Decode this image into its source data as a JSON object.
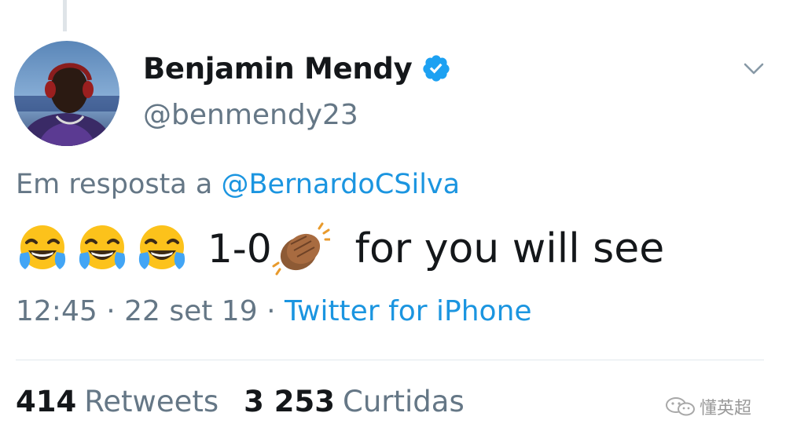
{
  "tweet": {
    "author": {
      "name": "Benjamin Mendy",
      "handle": "@benmendy23"
    },
    "reply_prefix": "Em resposta a ",
    "reply_to": "@BernardoCSilva",
    "text": {
      "emojis": [
        "face-with-tears-of-joy",
        "face-with-tears-of-joy",
        "face-with-tears-of-joy"
      ],
      "score": "1-0",
      "clap_emoji": "clapping-hands",
      "message": "for you will see"
    },
    "meta": {
      "time": "12:45",
      "separator1": " · ",
      "date": "22 set 19",
      "separator2": " · ",
      "source": "Twitter for iPhone"
    },
    "stats": {
      "retweets_count": "414",
      "retweets_label": "Retweets",
      "likes_count": "3 253",
      "likes_label": "Curtidas"
    }
  },
  "watermark": {
    "text": "懂英超"
  },
  "colors": {
    "link": "#1b95e0",
    "secondary_text": "#657786",
    "primary_text": "#14171a",
    "verified_badge": "#1da1f2"
  }
}
